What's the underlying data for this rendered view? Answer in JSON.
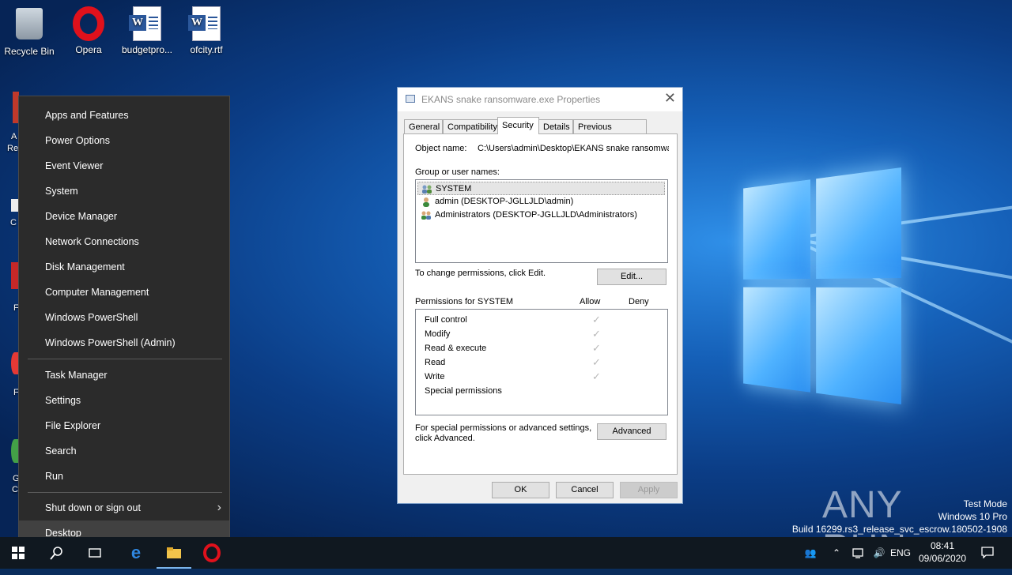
{
  "desktop": {
    "icons": [
      {
        "label": "Recycle Bin",
        "icon": "recycle-bin-icon"
      },
      {
        "label": "Opera",
        "icon": "opera-icon"
      },
      {
        "label": "budgetpro...",
        "icon": "word-document-icon"
      },
      {
        "label": "ofcity.rtf",
        "icon": "word-document-icon"
      }
    ],
    "partial_labels": [
      "A",
      "Re",
      "C",
      "F",
      "F",
      "G",
      "C"
    ],
    "watermark": "ANY RUN",
    "test_mode": {
      "line1": "Test Mode",
      "line2": "Windows 10 Pro",
      "line3": "Build 16299.rs3_release_svc_escrow.180502-1908"
    }
  },
  "winx_menu": {
    "group1": [
      "Apps and Features",
      "Power Options",
      "Event Viewer",
      "System",
      "Device Manager",
      "Network Connections",
      "Disk Management",
      "Computer Management",
      "Windows PowerShell",
      "Windows PowerShell (Admin)"
    ],
    "group2": [
      "Task Manager",
      "Settings",
      "File Explorer",
      "Search",
      "Run"
    ],
    "group3": [
      "Shut down or sign out",
      "Desktop"
    ],
    "active_item": "Desktop"
  },
  "dialog": {
    "title": "EKANS snake ransomware.exe Properties",
    "tabs": [
      "General",
      "Compatibility",
      "Security",
      "Details",
      "Previous Versions"
    ],
    "selected_tab": "Security",
    "object_name_label": "Object name:",
    "object_name_value": "C:\\Users\\admin\\Desktop\\EKANS snake ransomwa",
    "group_label": "Group or user names:",
    "groups": [
      "SYSTEM",
      "admin (DESKTOP-JGLLJLD\\admin)",
      "Administrators (DESKTOP-JGLLJLD\\Administrators)"
    ],
    "change_hint": "To change permissions, click Edit.",
    "edit_button": "Edit...",
    "permissions_label": "Permissions for SYSTEM",
    "allow_header": "Allow",
    "deny_header": "Deny",
    "permissions": [
      {
        "name": "Full control",
        "allow": true
      },
      {
        "name": "Modify",
        "allow": true
      },
      {
        "name": "Read & execute",
        "allow": true
      },
      {
        "name": "Read",
        "allow": true
      },
      {
        "name": "Write",
        "allow": true
      },
      {
        "name": "Special permissions",
        "allow": false
      }
    ],
    "advanced_hint_line1": "For special permissions or advanced settings,",
    "advanced_hint_line2": "click Advanced.",
    "advanced_button": "Advanced",
    "ok_button": "OK",
    "cancel_button": "Cancel",
    "apply_button": "Apply",
    "close_glyph": "✕"
  },
  "taskbar": {
    "language": "ENG",
    "time": "08:41",
    "date": "09/06/2020"
  },
  "colors": {
    "menu_bg": "#2b2b2b",
    "menu_active": "#414141",
    "taskbar_bg": "#101820",
    "dialog_bg": "#f0f0f0"
  }
}
